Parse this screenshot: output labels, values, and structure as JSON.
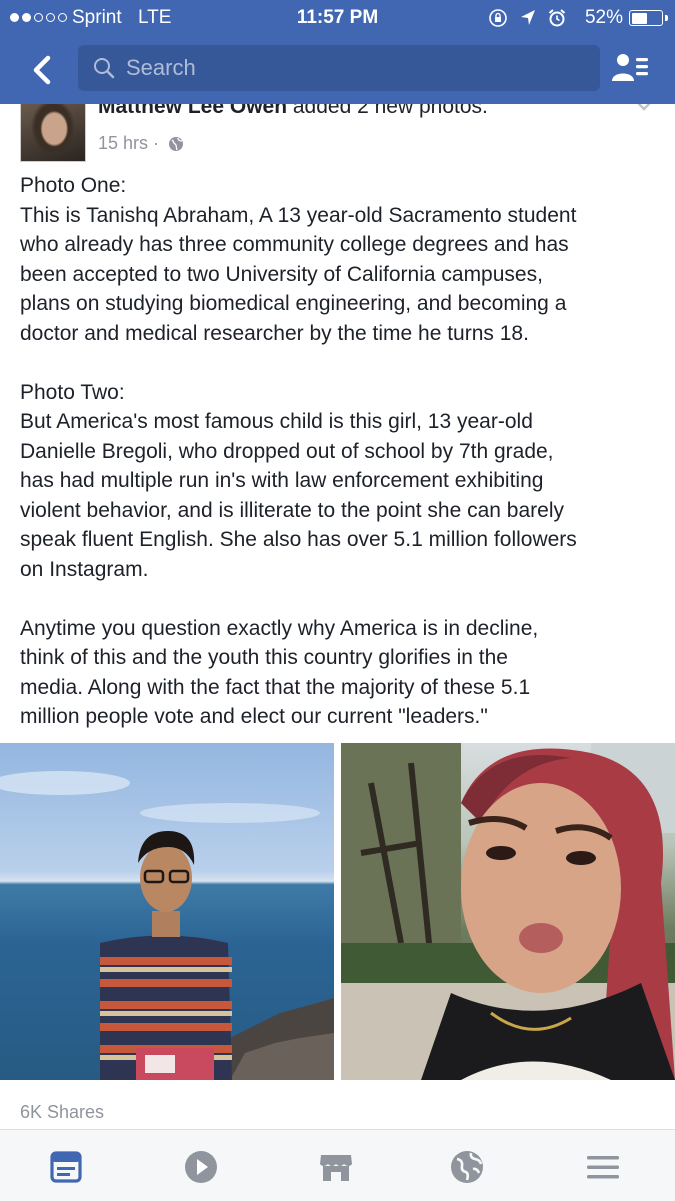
{
  "status_bar": {
    "signal_dots_filled": 2,
    "signal_dots_total": 5,
    "carrier": "Sprint",
    "network": "LTE",
    "time": "11:57 PM",
    "battery_percent": "52%",
    "battery_level": 0.52
  },
  "nav": {
    "search_placeholder": "Search"
  },
  "post": {
    "author_name": "Matthew Lee Owen",
    "action": "added 2 new photos.",
    "time": "15 hrs",
    "time_separator": "·",
    "paragraphs": [
      [
        "Photo One:",
        "This is Tanishq Abraham, A 13 year-old Sacramento student",
        "who already has three community college degrees and has",
        "been accepted to two University of California campuses,",
        "plans on studying biomedical engineering, and becoming a",
        "doctor and medical researcher by the time he turns 18."
      ],
      [
        "Photo Two:",
        "But America's most famous child is this girl, 13 year-old",
        "Danielle Bregoli, who dropped out of school by 7th grade,",
        "has had multiple run in's with law enforcement exhibiting",
        "violent behavior, and is illiterate to the point she can barely",
        "speak fluent English. She also has over 5.1 million followers",
        "on Instagram."
      ],
      [
        "Anytime you question exactly why America is in decline,",
        "think of this and the youth this country glorifies in the",
        "media. Along with the fact that the majority of these 5.1",
        "million people vote and elect our current \"leaders.\""
      ]
    ],
    "shares": "6K Shares"
  },
  "tab_bar": {
    "items": [
      {
        "icon": "news-feed-icon",
        "active": true
      },
      {
        "icon": "video-play-icon",
        "active": false
      },
      {
        "icon": "marketplace-icon",
        "active": false
      },
      {
        "icon": "globe-notifications-icon",
        "active": false
      },
      {
        "icon": "menu-icon",
        "active": false
      }
    ]
  },
  "colors": {
    "header_blue": "#4267b2",
    "search_box": "#365899",
    "active_tab": "#4267b2",
    "inactive_tab": "#90949c"
  }
}
